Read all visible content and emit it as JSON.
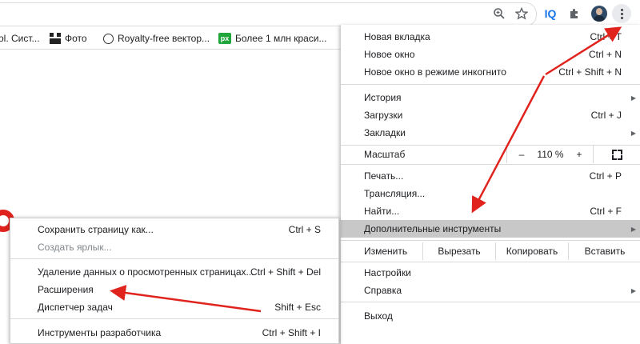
{
  "toolbar": {
    "icons": [
      "zoom-icon",
      "star-icon",
      "iq-extension-icon",
      "puzzle-icon",
      "profile-avatar",
      "kebab-menu-icon"
    ],
    "iq_label": "IQ"
  },
  "bookmarks": [
    {
      "label": "ol. Сист...",
      "icon": "none"
    },
    {
      "label": "Фото",
      "icon": "blocks-icon"
    },
    {
      "label": "Royalty-free вектор...",
      "icon": "globe-icon"
    },
    {
      "label": "Более 1 млн краси...",
      "icon": "px-icon",
      "icon_text": "px"
    }
  ],
  "menu": {
    "group1": [
      {
        "label": "Новая вкладка",
        "shortcut": "Ctrl + T"
      },
      {
        "label": "Новое окно",
        "shortcut": "Ctrl + N"
      },
      {
        "label": "Новое окно в режиме инкогнито",
        "shortcut": "Ctrl + Shift + N"
      }
    ],
    "group2": [
      {
        "label": "История",
        "shortcut": "",
        "submenu": true
      },
      {
        "label": "Загрузки",
        "shortcut": "Ctrl + J"
      },
      {
        "label": "Закладки",
        "shortcut": "",
        "submenu": true
      }
    ],
    "zoom": {
      "label": "Масштаб",
      "minus": "–",
      "value": "110 %",
      "plus": "+"
    },
    "group3": [
      {
        "label": "Печать...",
        "shortcut": "Ctrl + P"
      },
      {
        "label": "Трансляция...",
        "shortcut": ""
      },
      {
        "label": "Найти...",
        "shortcut": "Ctrl + F"
      },
      {
        "label": "Дополнительные инструменты",
        "shortcut": "",
        "submenu": true,
        "highlighted": true
      }
    ],
    "edit": {
      "label": "Изменить",
      "cut": "Вырезать",
      "copy": "Копировать",
      "paste": "Вставить"
    },
    "group4": [
      {
        "label": "Настройки",
        "shortcut": ""
      },
      {
        "label": "Справка",
        "shortcut": "",
        "submenu": true
      }
    ],
    "exit": {
      "label": "Выход"
    }
  },
  "submenu": {
    "items": [
      {
        "label": "Сохранить страницу как...",
        "shortcut": "Ctrl + S"
      },
      {
        "label": "Создать ярлык...",
        "shortcut": "",
        "disabled": true
      },
      {
        "label": "Удаление данных о просмотренных страницах...",
        "shortcut": "Ctrl + Shift + Del"
      },
      {
        "label": "Расширения",
        "shortcut": ""
      },
      {
        "label": "Диспетчер задач",
        "shortcut": "Shift + Esc"
      },
      {
        "label": "Инструменты разработчика",
        "shortcut": "Ctrl + Shift + I"
      }
    ]
  },
  "colors": {
    "highlight": "#c8c8c8",
    "annotation_arrow": "#e0231d",
    "px_badge": "#20a63b"
  }
}
